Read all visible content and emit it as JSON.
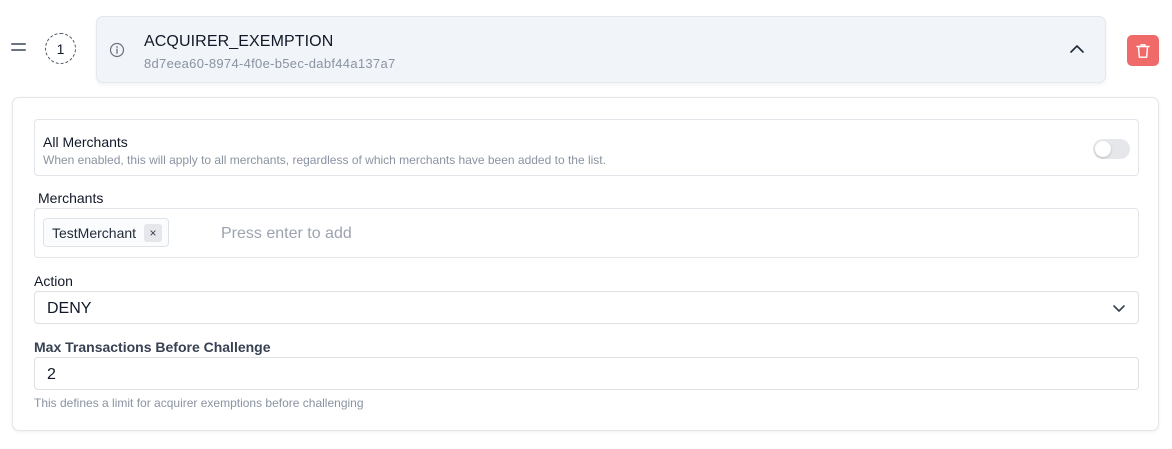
{
  "rule": {
    "step_number": "1",
    "title": "ACQUIRER_EXEMPTION",
    "id": "8d7eea60-8974-4f0e-b5ec-dabf44a137a7",
    "delete_color": "#f06a6a"
  },
  "all_merchants": {
    "title": "All Merchants",
    "description": "When enabled, this will apply to all merchants, regardless of which merchants have been added to the list.",
    "enabled": false
  },
  "merchants": {
    "label": "Merchants",
    "tags": [
      {
        "label": "TestMerchant",
        "remove_symbol": "×"
      }
    ],
    "placeholder": "Press enter to add"
  },
  "action": {
    "label": "Action",
    "selected": "DENY"
  },
  "max_transactions": {
    "label": "Max Transactions Before Challenge",
    "value": "2",
    "help": "This defines a limit for acquirer exemptions before challenging"
  },
  "icons": {
    "drag": "drag-handle-icon",
    "info": "info-icon",
    "collapse": "chevron-up-icon",
    "delete": "trash-icon",
    "dropdown": "chevron-down-icon",
    "remove_tag": "close-icon"
  }
}
